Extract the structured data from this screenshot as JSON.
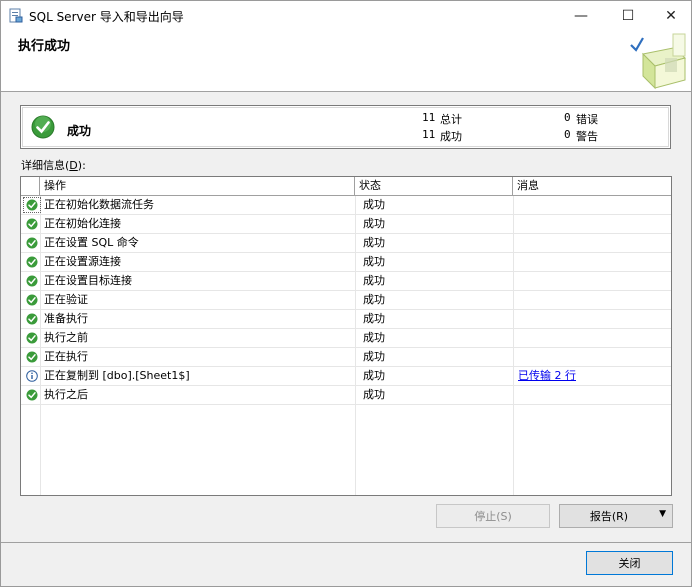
{
  "window": {
    "title": "SQL Server 导入和导出向导",
    "minimize": "—",
    "maximize": "☐",
    "close": "✕"
  },
  "header": {
    "title": "执行成功"
  },
  "summary": {
    "status": "成功",
    "total_count": "11",
    "total_label": "总计",
    "success_count": "11",
    "success_label": "成功",
    "error_count": "0",
    "error_label": "错误",
    "warning_count": "0",
    "warning_label": "警告"
  },
  "details": {
    "label_prefix": "详细信息(",
    "label_key": "D",
    "label_suffix": "):"
  },
  "grid": {
    "columns": [
      "操作",
      "状态",
      "消息"
    ],
    "rows": [
      {
        "icon": "success-icon",
        "op": "正在初始化数据流任务",
        "status": "成功",
        "msg": ""
      },
      {
        "icon": "success-icon",
        "op": "正在初始化连接",
        "status": "成功",
        "msg": ""
      },
      {
        "icon": "success-icon",
        "op": "正在设置 SQL 命令",
        "status": "成功",
        "msg": ""
      },
      {
        "icon": "success-icon",
        "op": "正在设置源连接",
        "status": "成功",
        "msg": ""
      },
      {
        "icon": "success-icon",
        "op": "正在设置目标连接",
        "status": "成功",
        "msg": ""
      },
      {
        "icon": "success-icon",
        "op": "正在验证",
        "status": "成功",
        "msg": ""
      },
      {
        "icon": "success-icon",
        "op": "准备执行",
        "status": "成功",
        "msg": ""
      },
      {
        "icon": "success-icon",
        "op": "执行之前",
        "status": "成功",
        "msg": ""
      },
      {
        "icon": "success-icon",
        "op": "正在执行",
        "status": "成功",
        "msg": ""
      },
      {
        "icon": "info-icon",
        "op": "正在复制到 [dbo].[Sheet1$]",
        "status": "成功",
        "msg": "已传输 2 行"
      },
      {
        "icon": "success-icon",
        "op": "执行之后",
        "status": "成功",
        "msg": ""
      }
    ]
  },
  "buttons": {
    "stop": "停止(S)",
    "report": "报告(R)",
    "report_arrow": "▼",
    "close": "关闭"
  },
  "colors": {
    "success": "#3a9b3a",
    "info": "#2f5f9e",
    "link": "#0000ee",
    "accent": "#0078d7"
  }
}
